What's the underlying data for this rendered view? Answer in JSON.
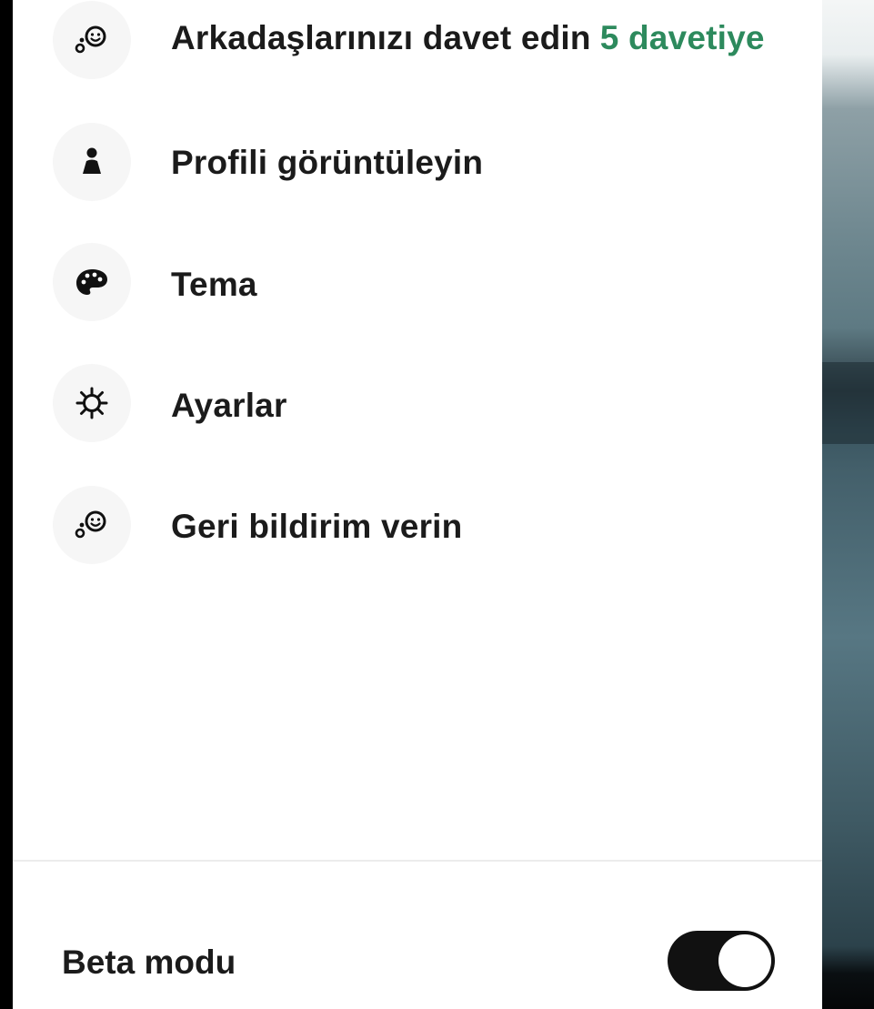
{
  "menu": {
    "items": [
      {
        "label": "Arkadaşlarınızı davet edin",
        "badge": "5 davetiye",
        "icon": "feedback-smiley-icon"
      },
      {
        "label": "Profili görüntüleyin",
        "icon": "person-icon"
      },
      {
        "label": "Tema",
        "icon": "palette-icon"
      },
      {
        "label": "Ayarlar",
        "icon": "gear-icon"
      },
      {
        "label": "Geri bildirim verin",
        "icon": "feedback-smiley-icon"
      }
    ]
  },
  "beta": {
    "label": "Beta modu",
    "enabled": true
  },
  "colors": {
    "accent_green": "#2d8a5d",
    "toggle_on": "#111111",
    "text": "#1b1b1b"
  }
}
